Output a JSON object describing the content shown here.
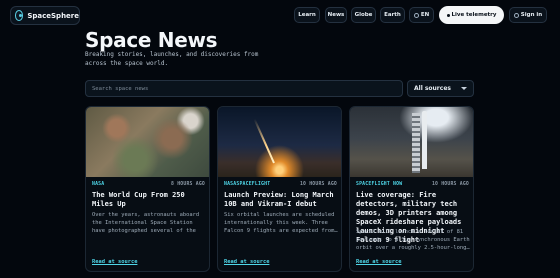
{
  "header": {
    "brand": "SpaceSphere",
    "nav": [
      "Learn",
      "News",
      "Globe",
      "Earth"
    ],
    "language": "EN",
    "telemetry": "Live telemetry",
    "signin": "Sign in"
  },
  "page": {
    "title": "Space News",
    "subtitle": "Breaking stories, launches, and discoveries from across the space world."
  },
  "search": {
    "placeholder": "Search space news"
  },
  "filter": {
    "selected": "All sources"
  },
  "cards": [
    {
      "agency": "NASA",
      "ago": "8 HOURS AGO",
      "title": "The World Cup From 250 Miles Up",
      "summary": "Over the years, astronauts aboard the International Space Station have photographed several of the cities…",
      "link": "Read at source"
    },
    {
      "agency": "NASASPACEFLIGHT",
      "ago": "10 HOURS AGO",
      "title": "Launch Preview: Long March 10B and Vikram-I debut",
      "summary": "Six orbital launches are scheduled internationally this week. Three Falcon 9 flights are expected from…",
      "link": "Read at source"
    },
    {
      "agency": "SPACEFLIGHT NOW",
      "ago": "10 HOURS AGO",
      "title": "Live coverage: Fire detectors, military tech demos, 3D printers among SpaceX rideshare payloads launching on midnight Falcon 9 flight",
      "summary": "SpaceX will launch a series of 81 payloads to a Sun-synchronous Earth orbit over a roughly 2.5-hour-long…",
      "link": "Read at source"
    }
  ],
  "colors": {
    "accent": "#4fd6e8",
    "background": "#03070d"
  }
}
